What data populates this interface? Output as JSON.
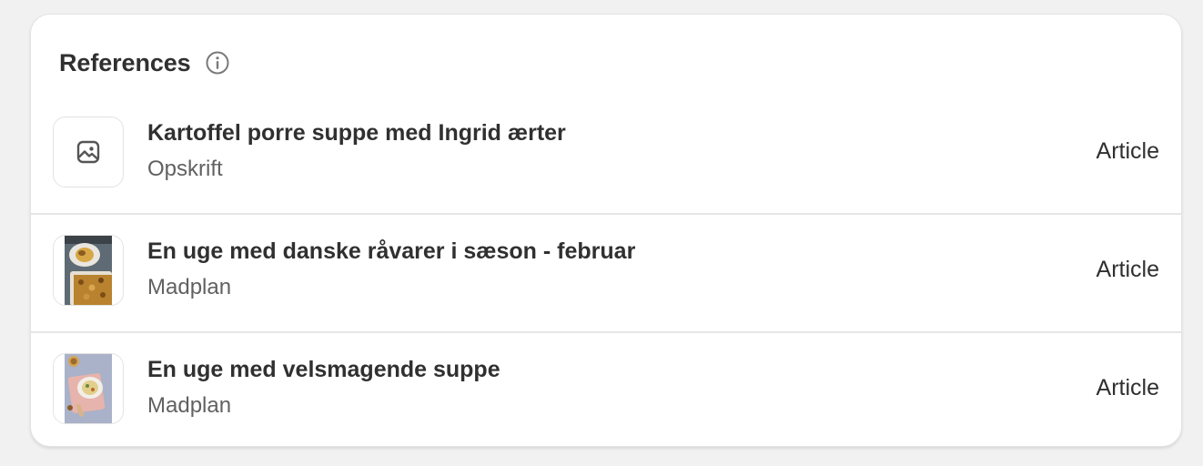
{
  "card": {
    "title": "References",
    "info_icon": "info-circle-icon"
  },
  "references": [
    {
      "title": "Kartoffel porre suppe med Ingrid ærter",
      "subtitle": "Opskrift",
      "type": "Article",
      "thumbnail": "image-placeholder-icon"
    },
    {
      "title": "En uge med danske råvarer i sæson - februar",
      "subtitle": "Madplan",
      "type": "Article",
      "thumbnail": "photo"
    },
    {
      "title": "En uge med velsmagende suppe",
      "subtitle": "Madplan",
      "type": "Article",
      "thumbnail": "photo"
    }
  ]
}
